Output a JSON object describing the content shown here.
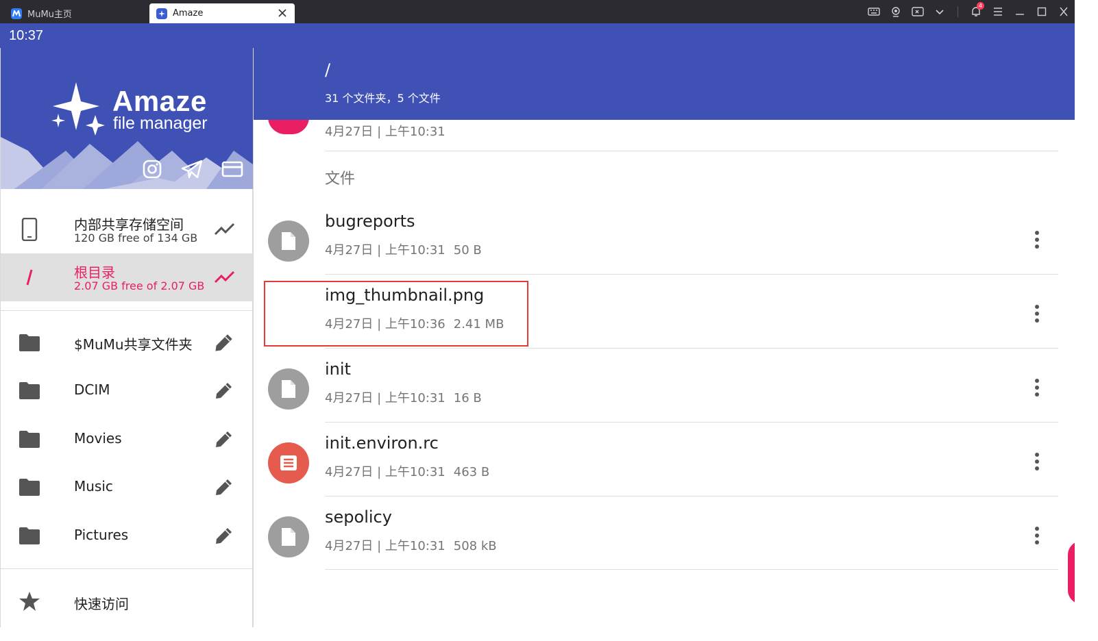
{
  "titlebar": {
    "tabs": [
      {
        "label": "MuMu主页",
        "active": false
      },
      {
        "label": "Amaze",
        "active": true
      }
    ],
    "notification_count": "4",
    "icons": [
      "keyboard-icon",
      "camera-icon",
      "screen-record-icon",
      "chevron-down-icon",
      "bell-icon",
      "menu-icon",
      "minimize-icon",
      "maximize-icon",
      "close-icon"
    ]
  },
  "status_bar": {
    "time": "10:37"
  },
  "drawer": {
    "brand": {
      "name": "Amaze",
      "subtitle": "file manager"
    },
    "header_buttons": [
      "instagram-icon",
      "telegram-icon",
      "card-icon"
    ],
    "storages": [
      {
        "title": "内部共享存储空间",
        "subtitle": "120 GB free of 134 GB",
        "icon": "phone-icon",
        "active": false
      },
      {
        "title": "根目录",
        "subtitle": "2.07 GB free of 2.07 GB",
        "icon": "root-slash-icon",
        "active": true
      }
    ],
    "folders": [
      {
        "label": "$MuMu共享文件夹"
      },
      {
        "label": "DCIM"
      },
      {
        "label": "Movies"
      },
      {
        "label": "Music"
      },
      {
        "label": "Pictures"
      }
    ],
    "quick_access": {
      "label": "快速访问"
    }
  },
  "main": {
    "path": "/",
    "summary": "31 个文件夹，5 个文件",
    "previous_item_date": "4月27日 | 上午10:31",
    "section_label": "文件",
    "files": [
      {
        "name": "bugreports",
        "date": "4月27日 | 上午10:31",
        "size": "50 B",
        "icon": "file-icon",
        "color": "#9e9e9e"
      },
      {
        "name": "img_thumbnail.png",
        "date": "4月27日 | 上午10:36",
        "size": "2.41 MB",
        "icon": "none",
        "color": "#ffffff"
      },
      {
        "name": "init",
        "date": "4月27日 | 上午10:31",
        "size": "16 B",
        "icon": "file-icon",
        "color": "#9e9e9e"
      },
      {
        "name": "init.environ.rc",
        "date": "4月27日 | 上午10:31",
        "size": "463 B",
        "icon": "text-file-icon",
        "color": "#e55b4d"
      },
      {
        "name": "sepolicy",
        "date": "4月27日 | 上午10:31",
        "size": "508 kB",
        "icon": "file-icon",
        "color": "#9e9e9e"
      }
    ]
  },
  "colors": {
    "primary": "#3f51b5",
    "accent": "#e91e63",
    "highlight": "#e53935"
  }
}
